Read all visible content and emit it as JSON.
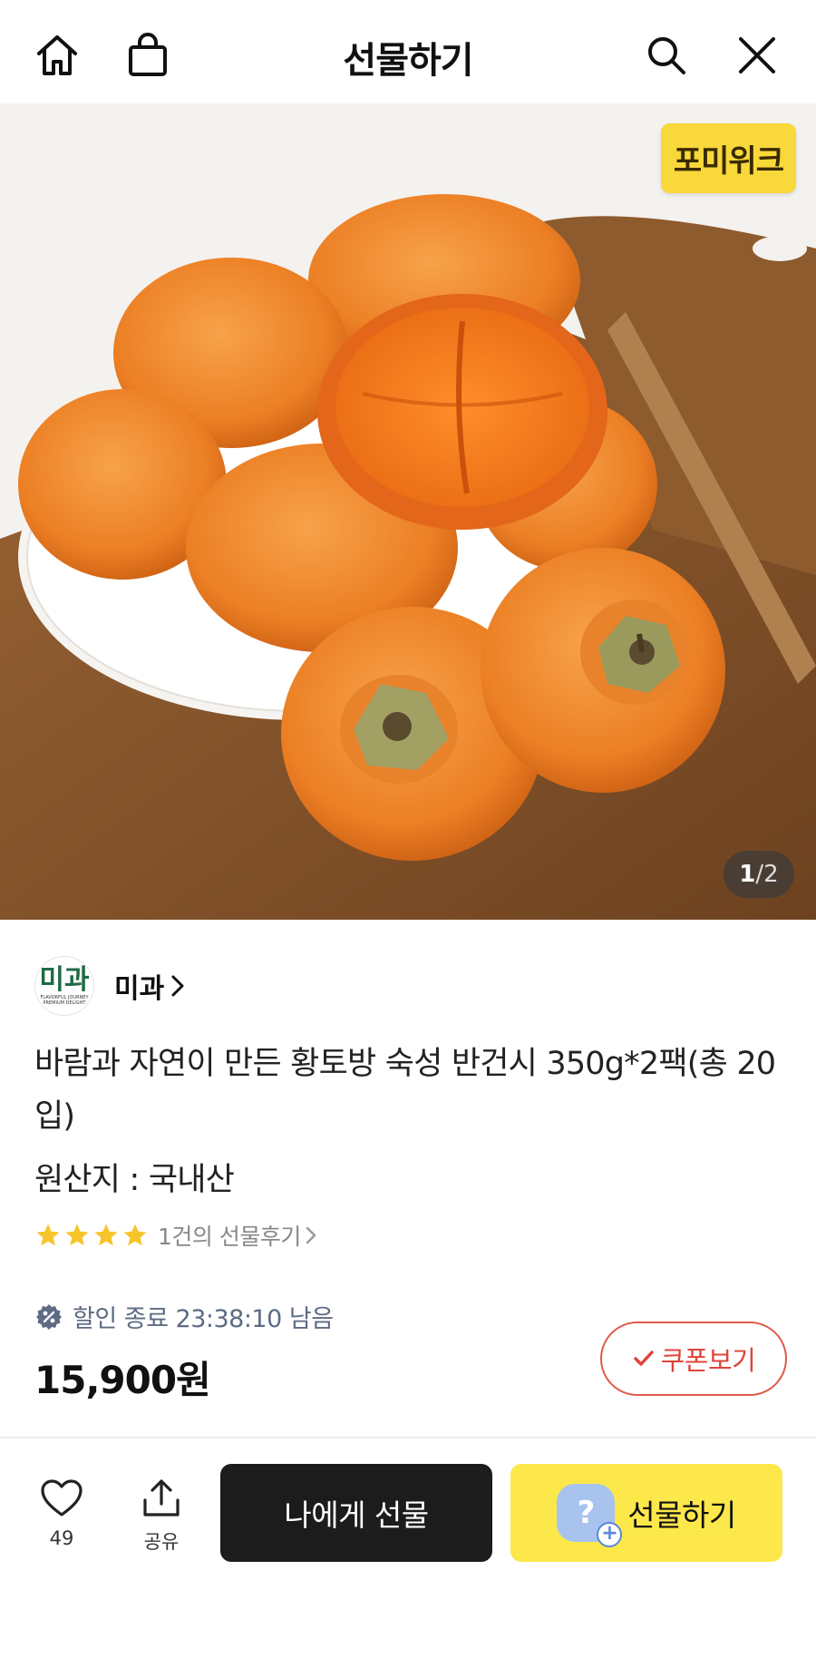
{
  "header": {
    "title": "선물하기",
    "icons": [
      "home-icon",
      "shopping-bag-icon",
      "search-icon",
      "close-icon"
    ]
  },
  "hero": {
    "brand_badge": "포미위크",
    "page_current": "1",
    "page_total": "/2"
  },
  "seller": {
    "logo_text": "미과",
    "logo_tagline": "FLAVORFUL JOURNEY PREMIUM DELIGHT",
    "name": "미과"
  },
  "product": {
    "title": "바람과 자연이 만든 황토방 숙성 반건시 350g*2팩(총 20입)",
    "origin": "원산지 : 국내산",
    "rating_stars": 4,
    "review_text": "1건의 선물후기",
    "sale_text": "할인 종료 23:38:10 남음",
    "price": "15,900원",
    "coupon_label": "쿠폰보기"
  },
  "bottom_bar": {
    "wish_count": "49",
    "share_label": "공유",
    "gift_self_label": "나에게 선물",
    "gift_label": "선물하기",
    "gift_avatar_text": "?"
  },
  "colors": {
    "kakao_yellow": "#fde84b",
    "coupon_red": "#e0443a",
    "star_yellow": "#f7c52b",
    "sale_blue": "#5d6b84"
  }
}
